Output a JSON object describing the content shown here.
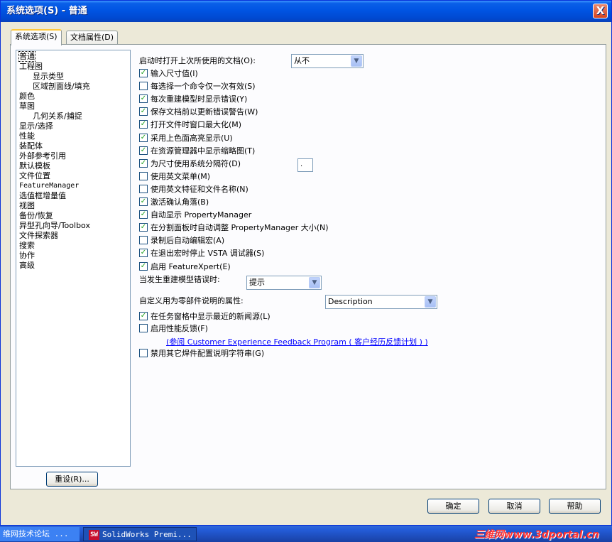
{
  "window": {
    "title": "系统选项(S) - 普通",
    "close_label": "X"
  },
  "tabs": [
    {
      "label": "系统选项(S)"
    },
    {
      "label": "文档属性(D)"
    }
  ],
  "tree": {
    "items": [
      {
        "label": "普通"
      },
      {
        "label": "工程图"
      },
      {
        "label": "显示类型"
      },
      {
        "label": "区域剖面线/填充"
      },
      {
        "label": "颜色"
      },
      {
        "label": "草图"
      },
      {
        "label": "几何关系/捕捉"
      },
      {
        "label": "显示/选择"
      },
      {
        "label": "性能"
      },
      {
        "label": "装配体"
      },
      {
        "label": "外部参考引用"
      },
      {
        "label": "默认模板"
      },
      {
        "label": "文件位置"
      },
      {
        "label": "FeatureManager"
      },
      {
        "label": "选值框增量值"
      },
      {
        "label": "视图"
      },
      {
        "label": "备份/恢复"
      },
      {
        "label": "异型孔向导/Toolbox"
      },
      {
        "label": "文件探索器"
      },
      {
        "label": "搜索"
      },
      {
        "label": "协作"
      },
      {
        "label": "高级"
      }
    ],
    "reset_label": "重设(R)..."
  },
  "options": {
    "open_last_label": "启动时打开上次所使用的文档(O):",
    "open_last_value": "从不",
    "checkboxes": [
      {
        "label": "输入尺寸值(I)",
        "checked": true
      },
      {
        "label": "每选择一个命令仅一次有效(S)",
        "checked": false
      },
      {
        "label": "每次重建模型时显示错误(Y)",
        "checked": true
      },
      {
        "label": "保存文档前以更新错误警告(W)",
        "checked": true
      },
      {
        "label": "打开文件时窗口最大化(M)",
        "checked": true
      },
      {
        "label": "采用上色面高亮显示(U)",
        "checked": true
      },
      {
        "label": "在资源管理器中显示缩略图(T)",
        "checked": true
      },
      {
        "label": "为尺寸使用系统分隔符(D)",
        "checked": true
      },
      {
        "label": "使用英文菜单(M)",
        "checked": false
      },
      {
        "label": "使用英文特征和文件名称(N)",
        "checked": false
      },
      {
        "label": "激活确认角落(B)",
        "checked": true
      },
      {
        "label": "自动显示 PropertyManager",
        "checked": true
      },
      {
        "label": "在分割面板时自动调整 PropertyManager 大小(N)",
        "checked": true
      },
      {
        "label": "录制后自动编辑宏(A)",
        "checked": false
      },
      {
        "label": "在退出宏时停止 VSTA 调试器(S)",
        "checked": true
      },
      {
        "label": "启用 FeatureXpert(E)",
        "checked": true
      }
    ],
    "separator_value": ".",
    "rebuild_error_label": "当发生重建模型错误时:",
    "rebuild_error_value": "提示",
    "custom_prop_label": "自定义用为零部件说明的属性:",
    "custom_prop_value": "Description",
    "checkboxes2": [
      {
        "label": "在任务窗格中显示最近的新闻源(L)",
        "checked": true
      },
      {
        "label": "启用性能反馈(F)",
        "checked": false
      }
    ],
    "feedback_link": "(参阅 Customer Experience Feedback Program ( 客户经历反馈计划 ) )",
    "checkboxes3": [
      {
        "label": "禁用其它焊件配置说明字符串(G)",
        "checked": false
      }
    ]
  },
  "footer": {
    "ok": "确定",
    "cancel": "取消",
    "help": "帮助"
  },
  "taskbar": {
    "task1": "维网技术论坛 ...",
    "task2": "SolidWorks Premi...",
    "task2_icon": "SW",
    "watermark": "三维网www.3dportal.cn"
  },
  "colors": {
    "titlebar": "#0054e3",
    "check": "#21a121",
    "link": "#0000ff"
  }
}
